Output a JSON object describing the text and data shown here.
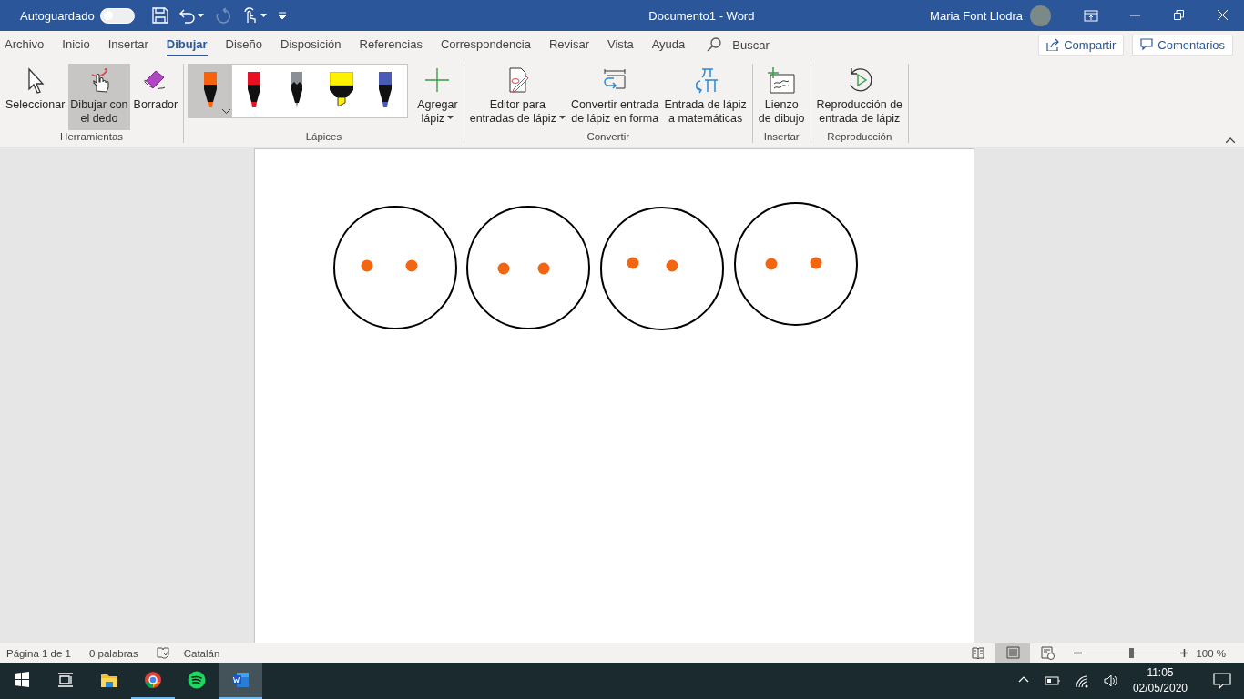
{
  "title_bar": {
    "autosave": {
      "label": "Autoguardado",
      "on": false
    },
    "quick_access": [
      {
        "kind": "save",
        "dropdown": false,
        "disabled": false
      },
      {
        "kind": "undo",
        "dropdown": true,
        "disabled": false
      },
      {
        "kind": "redo",
        "dropdown": false,
        "disabled": true
      },
      {
        "kind": "touch",
        "dropdown": true,
        "disabled": false
      },
      {
        "kind": "customize",
        "dropdown": false,
        "disabled": false
      }
    ],
    "title": "Documento1  -  Word",
    "user_name": "Maria Font Llodra"
  },
  "tabs": [
    {
      "label": "Archivo",
      "selected": false
    },
    {
      "label": "Inicio",
      "selected": false
    },
    {
      "label": "Insertar",
      "selected": false
    },
    {
      "label": "Dibujar",
      "selected": true
    },
    {
      "label": "Diseño",
      "selected": false
    },
    {
      "label": "Disposición",
      "selected": false
    },
    {
      "label": "Referencias",
      "selected": false
    },
    {
      "label": "Correspondencia",
      "selected": false
    },
    {
      "label": "Revisar",
      "selected": false
    },
    {
      "label": "Vista",
      "selected": false
    },
    {
      "label": "Ayuda",
      "selected": false
    }
  ],
  "search": {
    "placeholder": "Buscar"
  },
  "header_buttons": [
    {
      "kind": "share",
      "label": "Compartir"
    },
    {
      "kind": "comments",
      "label": "Comentarios"
    }
  ],
  "ribbon": {
    "groups": [
      {
        "label": "Herramientas",
        "items": [
          {
            "kind": "select",
            "label": "Seleccionar",
            "selected": false
          },
          {
            "kind": "finger",
            "label": "Dibujar con\nel dedo",
            "selected": true
          },
          {
            "kind": "eraser",
            "label": "Borrador",
            "selected": false
          }
        ]
      },
      {
        "label": "Lápices",
        "pens": [
          {
            "kind": "pen",
            "color": "#f7630c",
            "selected": true
          },
          {
            "kind": "pen",
            "color": "#e81123",
            "selected": false
          },
          {
            "kind": "pencil",
            "color": "#8a9096",
            "selected": false
          },
          {
            "kind": "highlighter",
            "color": "#fff100",
            "selected": false
          },
          {
            "kind": "pen",
            "color": "#4a5bb5",
            "selected": false
          }
        ],
        "items": [
          {
            "kind": "add",
            "label": "Agregar\nlápiz",
            "dropdown": true
          }
        ]
      },
      {
        "label": "Convertir",
        "items": [
          {
            "kind": "ink-editor",
            "label": "Editor para\nentradas de lápiz",
            "dropdown": true
          },
          {
            "kind": "ink-shape",
            "label": "Convertir entrada\nde lápiz en forma",
            "dropdown": false
          },
          {
            "kind": "ink-math",
            "label": "Entrada de lápiz\na matemáticas",
            "dropdown": false
          }
        ]
      },
      {
        "label": "Insertar",
        "items": [
          {
            "kind": "canvas",
            "label": "Lienzo\nde dibujo",
            "dropdown": false
          }
        ]
      },
      {
        "label": "Reproducción",
        "items": [
          {
            "kind": "replay",
            "label": "Reproducción de\nentrada de lápiz",
            "dropdown": false
          }
        ]
      }
    ]
  },
  "status_bar": {
    "page": "Página 1 de 1",
    "words": "0 palabras",
    "language": "Catalán",
    "views": [
      {
        "kind": "read",
        "selected": false
      },
      {
        "kind": "print",
        "selected": true
      },
      {
        "kind": "web",
        "selected": false
      }
    ],
    "zoom": {
      "level": 0.5,
      "reading": "100 %"
    }
  },
  "taskbar": {
    "apps": [
      {
        "kind": "explorer",
        "running": false,
        "selected": false
      },
      {
        "kind": "chrome",
        "running": true,
        "selected": false
      },
      {
        "kind": "spotify",
        "running": false,
        "selected": false
      },
      {
        "kind": "word",
        "running": true,
        "selected": true
      }
    ],
    "time": "11:05",
    "date": "02/05/2020"
  }
}
